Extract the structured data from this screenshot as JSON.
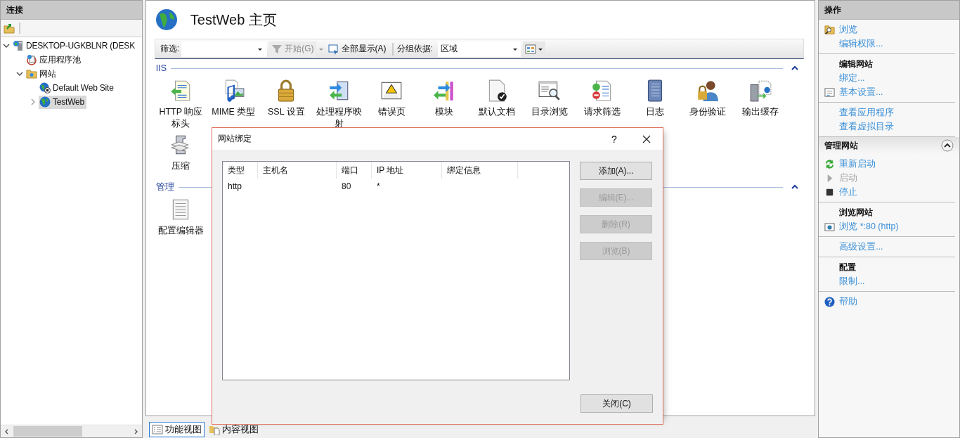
{
  "connections": {
    "title": "连接",
    "tree": [
      {
        "label": "DESKTOP-UGKBLNR (DESK",
        "kind": "server",
        "expanded": true,
        "selected": false,
        "children": [
          {
            "label": "应用程序池",
            "kind": "apppool",
            "selected": false
          },
          {
            "label": "网站",
            "kind": "folder",
            "expanded": true,
            "selected": false,
            "children": [
              {
                "label": "Default Web Site",
                "kind": "site-stopped",
                "selected": false
              },
              {
                "label": "TestWeb",
                "kind": "site",
                "expanded": false,
                "selected": true
              }
            ]
          }
        ]
      }
    ]
  },
  "page": {
    "title": "TestWeb 主页",
    "toolbar": {
      "filter_label": "筛选:",
      "go": {
        "label": "开始(G)",
        "disabled": true
      },
      "show_all": {
        "label": "全部显示(A)",
        "disabled": false
      },
      "group_label": "分组依据:",
      "group_value": "区域"
    },
    "sections": [
      {
        "title": "IIS",
        "expanded": true,
        "features": [
          {
            "label": "HTTP 响应标头",
            "kind": "http-headers"
          },
          {
            "label": "MIME 类型",
            "kind": "mime"
          },
          {
            "label": "SSL 设置",
            "kind": "ssl"
          },
          {
            "label": "处理程序映射",
            "kind": "handler"
          },
          {
            "label": "错误页",
            "kind": "error"
          },
          {
            "label": "模块",
            "kind": "modules"
          },
          {
            "label": "默认文档",
            "kind": "default-doc"
          },
          {
            "label": "目录浏览",
            "kind": "dir-browse"
          },
          {
            "label": "请求筛选",
            "kind": "request-filter"
          },
          {
            "label": "日志",
            "kind": "logging"
          },
          {
            "label": "身份验证",
            "kind": "auth"
          },
          {
            "label": "输出缓存",
            "kind": "output-cache"
          },
          {
            "label": "压缩",
            "kind": "compression"
          }
        ]
      },
      {
        "title": "管理",
        "expanded": true,
        "features": [
          {
            "label": "配置编辑器",
            "kind": "config-editor"
          }
        ]
      }
    ],
    "view_tabs": [
      {
        "label": "功能视图",
        "selected": true
      },
      {
        "label": "内容视图",
        "selected": false
      }
    ]
  },
  "dialog": {
    "title": "网站绑定",
    "help": "?",
    "columns": [
      "类型",
      "主机名",
      "端口",
      "IP 地址",
      "绑定信息"
    ],
    "rows": [
      {
        "type": "http",
        "port": "80",
        "ip": "*"
      }
    ],
    "buttons": [
      {
        "label": "添加(A)...",
        "disabled": false
      },
      {
        "label": "编辑(E)...",
        "disabled": true
      },
      {
        "label": "删除(R)",
        "disabled": true
      },
      {
        "label": "浏览(B)",
        "disabled": true
      }
    ],
    "close_button": "关闭(C)"
  },
  "actions": {
    "title": "操作",
    "groups": [
      {
        "items": [
          {
            "label": "浏览",
            "kind": "browse",
            "disabled": false
          },
          {
            "label": "编辑权限...",
            "disabled": false
          }
        ]
      },
      {
        "title": "编辑网站",
        "items": [
          {
            "label": "绑定...",
            "disabled": false
          },
          {
            "label": "基本设置...",
            "kind": "settings",
            "disabled": false
          }
        ]
      },
      {
        "items": [
          {
            "label": "查看应用程序",
            "disabled": false
          },
          {
            "label": "查看虚拟目录",
            "disabled": false
          }
        ]
      },
      {
        "header": "管理网站",
        "expanded": true,
        "items": [
          {
            "label": "重新启动",
            "kind": "restart",
            "disabled": false
          },
          {
            "label": "启动",
            "kind": "start",
            "disabled": true
          },
          {
            "label": "停止",
            "kind": "stop",
            "disabled": false
          }
        ]
      },
      {
        "title": "浏览网站",
        "items": [
          {
            "label": "浏览 *:80 (http)",
            "kind": "browse-site",
            "disabled": false
          }
        ]
      },
      {
        "items": [
          {
            "label": "高级设置...",
            "disabled": false
          }
        ]
      },
      {
        "title": "配置",
        "items": [
          {
            "label": "限制...",
            "disabled": false
          }
        ]
      },
      {
        "items": [
          {
            "label": "帮助",
            "kind": "help",
            "disabled": false
          }
        ]
      }
    ]
  }
}
